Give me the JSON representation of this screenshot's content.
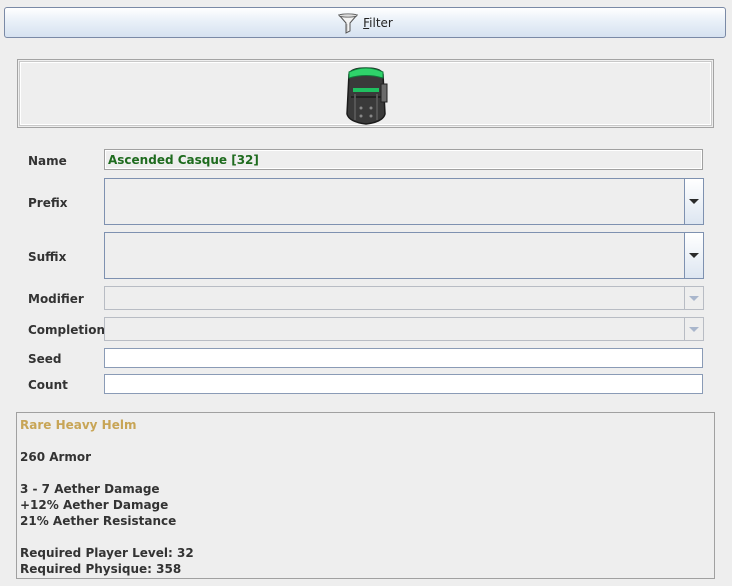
{
  "toolbar": {
    "filter_label": "Filter",
    "filter_icon": "funnel-icon"
  },
  "item": {
    "icon": "heavy-helm-icon",
    "fields": {
      "name_label": "Name",
      "name_value": "Ascended Casque [32]",
      "prefix_label": "Prefix",
      "prefix_value": "",
      "suffix_label": "Suffix",
      "suffix_value": "",
      "modifier_label": "Modifier",
      "modifier_value": "",
      "completion_label": "Completion",
      "completion_value": "",
      "seed_label": "Seed",
      "seed_value": "",
      "count_label": "Count",
      "count_value": ""
    },
    "description": {
      "rarity": "Rare Heavy Helm",
      "armor": "260 Armor",
      "stats": [
        "3 - 7 Aether Damage",
        "+12% Aether Damage",
        "21% Aether Resistance"
      ],
      "requirements": [
        "Required Player Level: 32",
        "Required Physique: 358"
      ]
    }
  },
  "colors": {
    "rarity": "#c8a556",
    "name_text": "#1e6b1e",
    "combo_border": "#7e91b0"
  }
}
